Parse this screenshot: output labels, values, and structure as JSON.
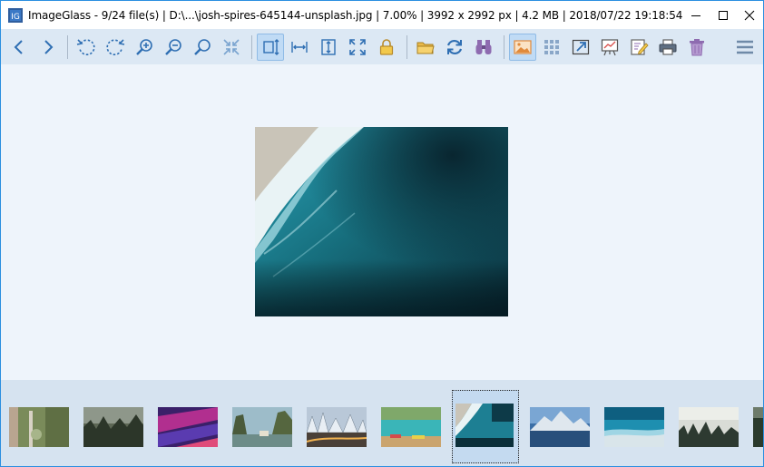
{
  "window": {
    "title": "ImageGlass - 9/24 file(s)  |  D:\\...\\josh-spires-645144-unsplash.jpg  |  7.00%  |  3992 x 2992 px  |  4.2 MB  |  2018/07/22 19:18:54",
    "app_icon": "imageglass-app-icon",
    "controls": [
      "minimize-icon",
      "maximize-icon",
      "close-icon"
    ]
  },
  "toolbar": {
    "buttons": [
      {
        "icon": "back-icon"
      },
      {
        "icon": "forward-icon"
      },
      {
        "icon": "rotate-left-icon"
      },
      {
        "icon": "rotate-right-icon"
      },
      {
        "icon": "zoom-in-icon"
      },
      {
        "icon": "zoom-out-icon"
      },
      {
        "icon": "actual-size-icon"
      },
      {
        "icon": "auto-zoom-icon"
      },
      {
        "icon": "scale-to-height-icon",
        "active": true
      },
      {
        "icon": "scale-to-width-icon"
      },
      {
        "icon": "fit-height-icon"
      },
      {
        "icon": "fill-window-icon"
      },
      {
        "icon": "lock-zoom-icon"
      },
      {
        "icon": "open-folder-icon"
      },
      {
        "icon": "refresh-icon"
      },
      {
        "icon": "find-icon"
      },
      {
        "icon": "thumbnail-bar-icon",
        "active": true
      },
      {
        "icon": "checkerboard-icon"
      },
      {
        "icon": "full-screen-icon"
      },
      {
        "icon": "slideshow-icon"
      },
      {
        "icon": "edit-icon"
      },
      {
        "icon": "print-icon"
      },
      {
        "icon": "delete-icon"
      },
      {
        "icon": "menu-icon"
      }
    ]
  },
  "viewer": {
    "image_name": "josh-spires-645144-unsplash.jpg"
  },
  "thumbnails": {
    "count_visible": 11,
    "selected_index": 6,
    "items": [
      {
        "subject": "birch-trees"
      },
      {
        "subject": "misty-forest"
      },
      {
        "subject": "purple-abstract"
      },
      {
        "subject": "halong-bay"
      },
      {
        "subject": "snowy-trees-lights"
      },
      {
        "subject": "boats-lake"
      },
      {
        "subject": "ocean-aerial"
      },
      {
        "subject": "mountain-lake"
      },
      {
        "subject": "shoreline-aerial"
      },
      {
        "subject": "foggy-pine-forest"
      },
      {
        "subject": "dark-forest"
      }
    ]
  },
  "colors": {
    "accent": "#2b8fe0",
    "toolbar_bg": "#dce8f4",
    "viewer_bg": "#eef4fb",
    "thumbbar_bg": "#d6e3f0",
    "icon_blue": "#2f6fb3",
    "icon_purple": "#8e6bb0"
  }
}
